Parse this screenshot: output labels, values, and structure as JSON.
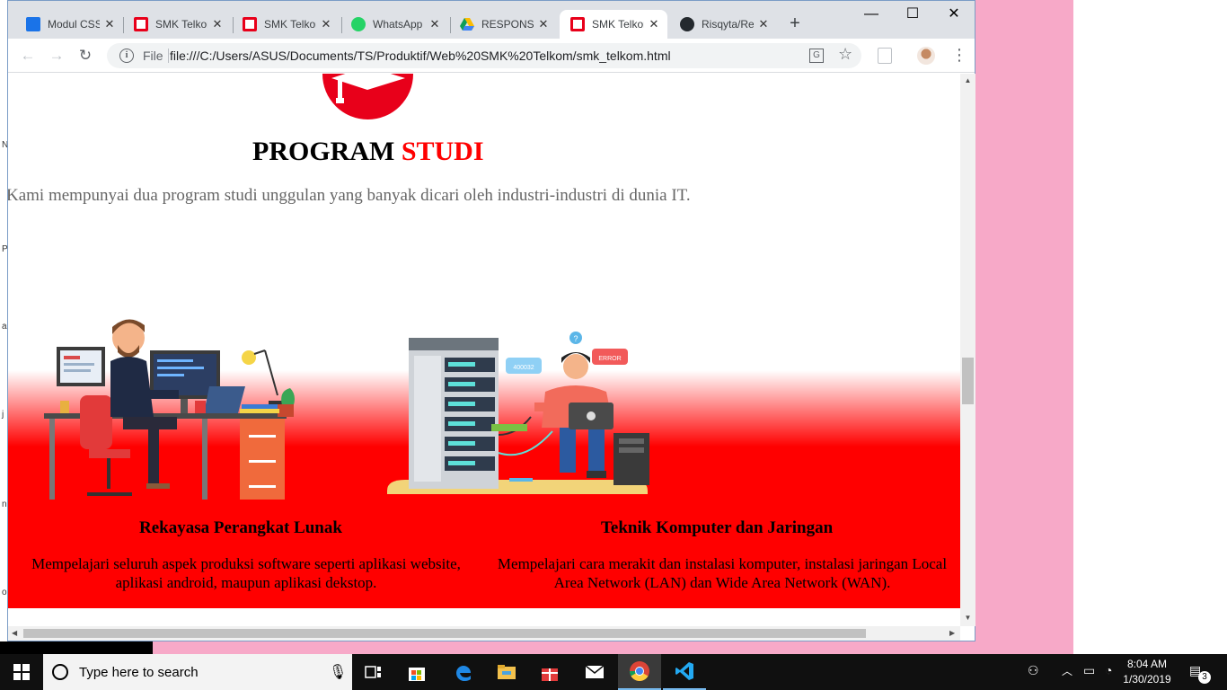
{
  "browser": {
    "tabs": [
      {
        "title": "Modul CSS",
        "favicon": "person-card-icon",
        "color": "#1a73e8"
      },
      {
        "title": "SMK Telkom",
        "favicon": "telkom-logo-icon",
        "color": "#e8001a"
      },
      {
        "title": "SMK Telkom",
        "favicon": "telkom-logo-icon",
        "color": "#e8001a"
      },
      {
        "title": "WhatsApp",
        "favicon": "whatsapp-icon",
        "color": "#25d366"
      },
      {
        "title": "RESPONSIVE",
        "favicon": "google-drive-icon",
        "color": "#fbbc04"
      },
      {
        "title": "SMK Telkom",
        "favicon": "telkom-logo-icon",
        "color": "#e8001a",
        "active": true
      },
      {
        "title": "Risqyta/Re",
        "favicon": "github-icon",
        "color": "#24292e"
      }
    ],
    "new_tab": "+",
    "window_controls": {
      "minimize": "—",
      "maximize": "☐",
      "close": "✕"
    },
    "address": {
      "scheme_label": "File",
      "url": "file:///C:/Users/ASUS/Documents/TS/Produktif/Web%20SMK%20Telkom/smk_telkom.html"
    }
  },
  "page": {
    "heading": {
      "part1": "PROGRAM",
      "part2": "STUDI"
    },
    "intro": "Kami mempunyai dua program studi unggulan yang banyak dicari oleh industri-industri di dunia IT.",
    "programs": [
      {
        "title": "Rekayasa Perangkat Lunak",
        "description": "Mempelajari seluruh aspek produksi software seperti aplikasi website, aplikasi android, maupun aplikasi dekstop."
      },
      {
        "title": "Teknik Komputer dan Jaringan",
        "description": "Mempelajari cara merakit dan instalasi komputer, instalasi jaringan Local Area Network (LAN) dan Wide Area Network (WAN).",
        "illustration_labels": {
          "bubble1": "400032",
          "bubble2": "ERROR",
          "question": "?"
        }
      }
    ],
    "accent_color": "#ff0000"
  },
  "desktop": {
    "left_edge_letters": [
      "N",
      "P",
      "a",
      "j",
      "n",
      "o"
    ]
  },
  "taskbar": {
    "search_placeholder": "Type here to search",
    "clock": {
      "time": "8:04 AM",
      "date": "1/30/2019"
    },
    "notification_count": "3"
  }
}
